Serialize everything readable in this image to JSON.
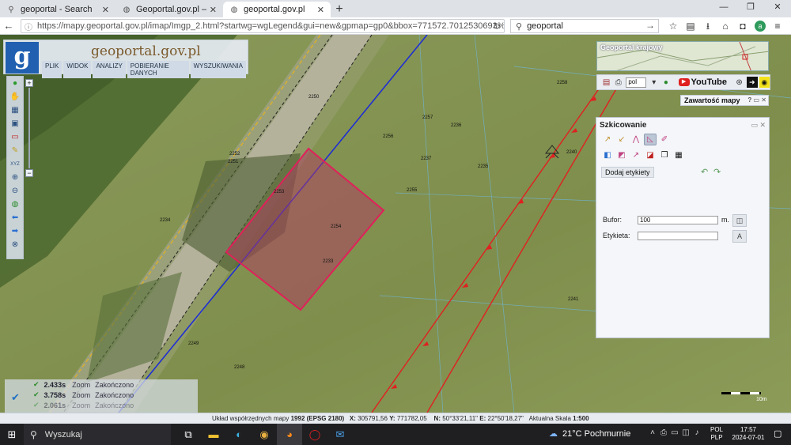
{
  "browser": {
    "tabs": [
      {
        "label": "geoportal - Search",
        "icon": "search-icon"
      },
      {
        "label": "Geoportal.gov.pl – Geop…",
        "icon": "globe-icon"
      },
      {
        "label": "geoportal.gov.pl",
        "icon": "globe-icon"
      }
    ],
    "address": "https://mapy.geoportal.gov.pl/imap/Imgp_2.html?startwg=wgLegend&gui=new&gpmap=gp0&bbox=771572.7012530693%2C3(",
    "search_value": "geoportal",
    "window_controls": [
      "—",
      "❐",
      "✕"
    ]
  },
  "app": {
    "site_name": "geoportal.gov.pl",
    "logo_letter": "g",
    "menu": [
      "PLIK",
      "WIDOK",
      "ANALIZY",
      "POBIERANIE DANYCH",
      "WYSZUKIWANIA"
    ]
  },
  "overview": {
    "title": "Geoportal krajowy"
  },
  "toolbar_right": {
    "language": "pol",
    "youtube": "YouTube"
  },
  "content_panel": {
    "title": "Zawartość mapy",
    "controls": "? ▭ ✕"
  },
  "sketch_panel": {
    "title": "Szkicowanie",
    "add_label_button": "Dodaj etykiety",
    "buffer_label": "Bufor:",
    "buffer_value": "100",
    "buffer_unit": "m.",
    "label_label": "Etykieta:",
    "label_value": ""
  },
  "map_labels": [
    "2253",
    "2254",
    "2255",
    "2256",
    "2257",
    "2252",
    "2251",
    "2250",
    "2234",
    "2233",
    "2235",
    "2236",
    "2237",
    "2240",
    "2241",
    "2258",
    "2249",
    "2248"
  ],
  "status_log": [
    {
      "time": "2.433s",
      "label": "Zoom",
      "state": "Zakończono"
    },
    {
      "time": "3.758s",
      "label": "Zoom",
      "state": "Zakończono"
    },
    {
      "time": "2.061s",
      "label": "Zoom",
      "state": "Zakończono"
    }
  ],
  "scale": {
    "label": "10m"
  },
  "coordinates": {
    "system_label": "Układ współrzędnych mapy",
    "system_value": "1992 (EPSG 2180)",
    "x_label": "X:",
    "x_value": "305791,56",
    "y_label": "Y:",
    "y_value": "771782,05",
    "n_label": "N:",
    "n_value": "50°33'21,11\"",
    "e_label": "E:",
    "e_value": "22°50'18,27\"",
    "scale_label": "Aktualna Skala",
    "scale_value": "1:500"
  },
  "taskbar": {
    "search_placeholder": "Wyszukaj",
    "weather": "21°C  Pochmurnie",
    "language": [
      "POL",
      "PLP"
    ],
    "time": "17:57",
    "date": "2024-07-01"
  },
  "colors": {
    "parcel_fill": "#b03a62",
    "parcel_stroke": "#e0205a",
    "powerline": "#e02020",
    "boundary_blue": "#1a2ad8"
  }
}
